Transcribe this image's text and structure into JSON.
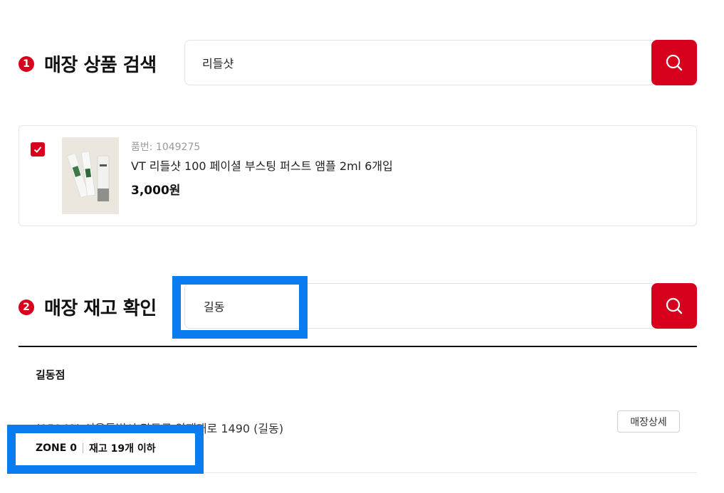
{
  "section1": {
    "step": "1",
    "title": "매장 상품 검색",
    "search_value": "리들샷",
    "search_icon": "search-icon"
  },
  "product": {
    "checked": true,
    "id_text": "품번: 1049275",
    "name": "VT 리들샷 100 페이셜 부스팅 퍼스트 앰플 2ml 6개입",
    "price": "3,000원"
  },
  "section2": {
    "step": "2",
    "title": "매장 재고 확인",
    "search_value": "길동",
    "search_icon": "search-icon"
  },
  "store": {
    "name": "길동점",
    "address": "(05243) 서울특별시 강동구 양재대로 1490 (길동)",
    "detail_label": "매장상세",
    "zone_label": "ZONE 0",
    "stock_label": "재고 19개 이하"
  },
  "colors": {
    "accent": "#d7001d",
    "highlight": "#0a7cf0"
  }
}
